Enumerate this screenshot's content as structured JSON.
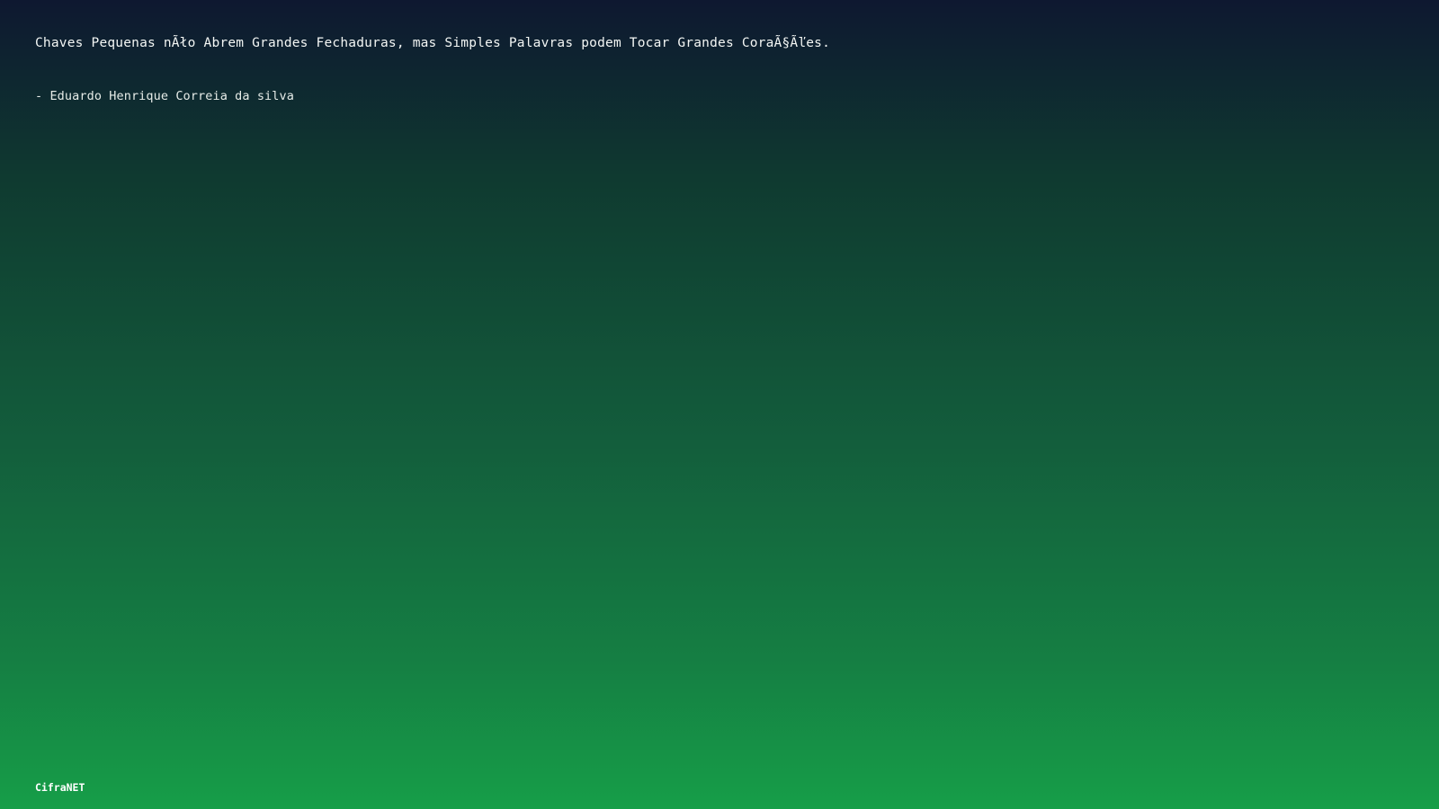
{
  "quote": {
    "text": "Chaves Pequenas nÃło Abrem Grandes Fechaduras, mas Simples Palavras podem Tocar Grandes CoraÃ§Ãľes.",
    "author": "- Eduardo Henrique Correia da silva"
  },
  "footer": {
    "brand": "CifraNET"
  },
  "colors": {
    "gradient_top": "#0e1830",
    "gradient_bottom": "#169e48",
    "text": "#ffffff"
  }
}
